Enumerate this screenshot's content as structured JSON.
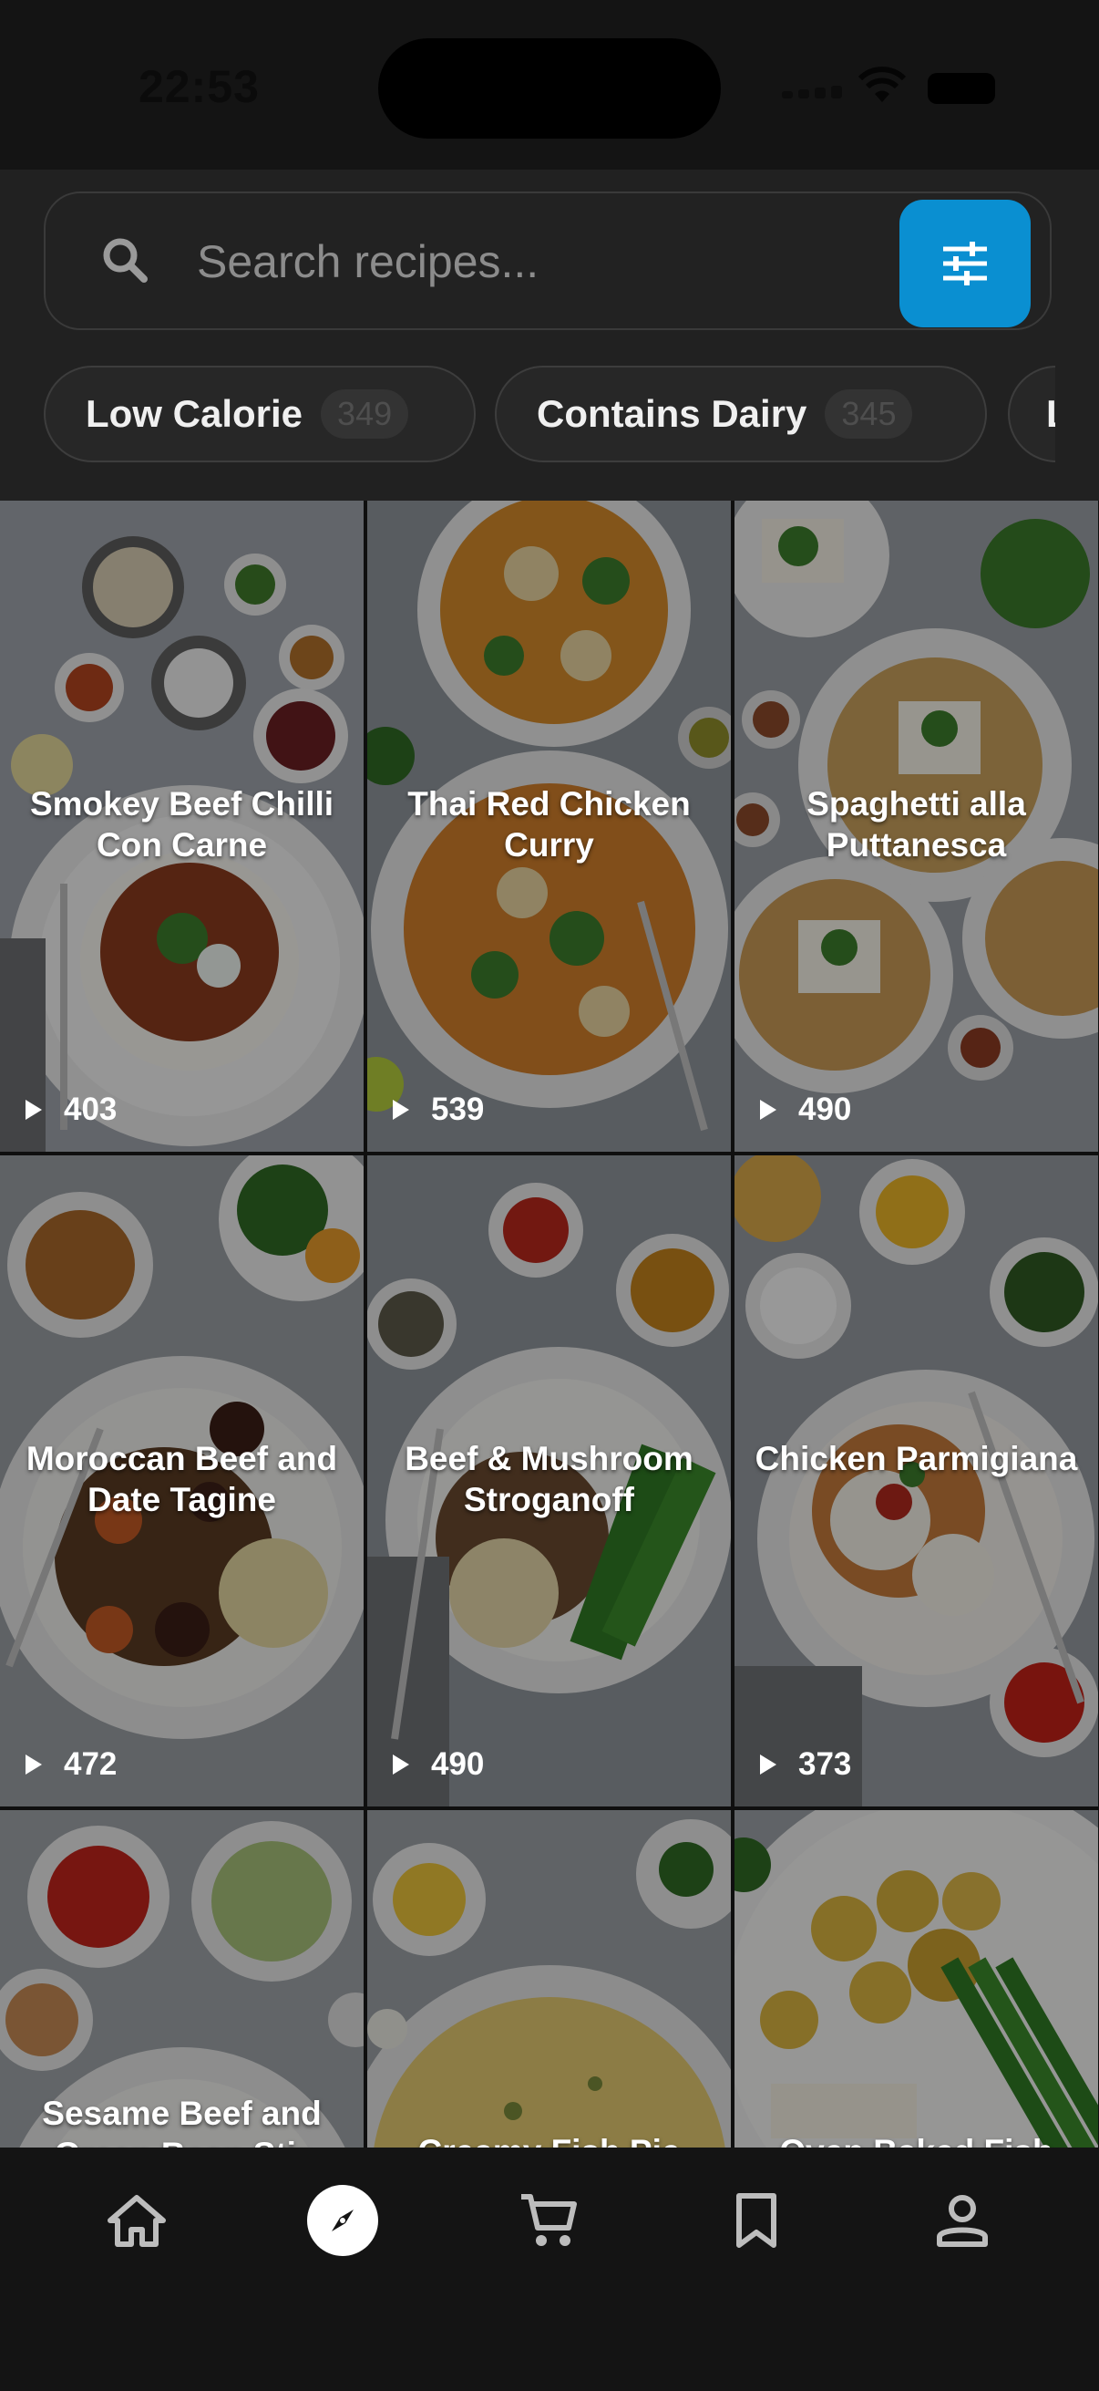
{
  "status_bar": {
    "time": "22:53"
  },
  "search": {
    "placeholder": "Search recipes..."
  },
  "chips": [
    {
      "label": "Low Calorie",
      "count": "349"
    },
    {
      "label": "Contains Dairy",
      "count": "345"
    },
    {
      "label": "L",
      "count": ""
    }
  ],
  "recipes": [
    {
      "title": "Smokey Beef Chilli Con Carne",
      "views": "403"
    },
    {
      "title": "Thai Red Chicken Curry",
      "views": "539"
    },
    {
      "title": "Spaghetti alla Puttanesca",
      "views": "490"
    },
    {
      "title": "Moroccan Beef and Date Tagine",
      "views": "472"
    },
    {
      "title": "Beef & Mushroom Stroganoff",
      "views": "490"
    },
    {
      "title": "Chicken Parmigiana",
      "views": "373"
    },
    {
      "title": "Sesame Beef and Green Bean Stir",
      "views": ""
    },
    {
      "title": "Creamy Fish Pie",
      "views": ""
    },
    {
      "title": "Oven Baked Fish",
      "views": ""
    }
  ],
  "nav": {
    "items": [
      "home-icon",
      "explore-icon",
      "cart-icon",
      "bookmark-icon",
      "profile-icon"
    ],
    "active": "explore-icon"
  },
  "colors": {
    "accent": "#0a8fd1",
    "background": "#131313",
    "surface": "#212121"
  }
}
